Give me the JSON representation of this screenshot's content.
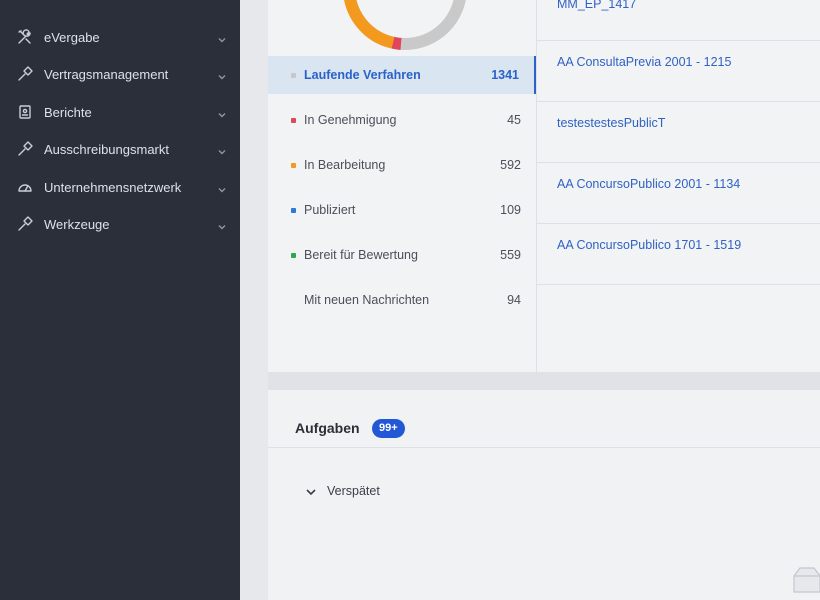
{
  "sidebar": {
    "items": [
      {
        "label": "eVergabe",
        "icon": "tools-icon"
      },
      {
        "label": "Vertragsmanagement",
        "icon": "hammer-icon"
      },
      {
        "label": "Berichte",
        "icon": "report-icon"
      },
      {
        "label": "Ausschreibungsmarkt",
        "icon": "hammer-icon"
      },
      {
        "label": "Unternehmensnetzwerk",
        "icon": "dashboard-icon"
      },
      {
        "label": "Werkzeuge",
        "icon": "hammer-icon"
      }
    ]
  },
  "statuses": [
    {
      "label": "Laufende Verfahren",
      "count": "1341",
      "color": "#c8c8c8",
      "active": true
    },
    {
      "label": "In Genehmigung",
      "count": "45",
      "color": "#e0455a",
      "active": false
    },
    {
      "label": "In Bearbeitung",
      "count": "592",
      "color": "#f39a1e",
      "active": false
    },
    {
      "label": "Publiziert",
      "count": "109",
      "color": "#2e78dc",
      "active": false
    },
    {
      "label": "Bereit für Bewertung",
      "count": "559",
      "color": "#2ea84d",
      "active": false
    },
    {
      "label": "Mit neuen Nachrichten",
      "count": "94",
      "color": "",
      "active": false
    }
  ],
  "procedures": [
    {
      "label": "MM_EP_1417"
    },
    {
      "label": "AA ConsultaPrevia 2001 - 1215"
    },
    {
      "label": "testestestesPublicT"
    },
    {
      "label": "AA ConcursoPublico 2001 - 1134"
    },
    {
      "label": "AA ConcursoPublico 1701 - 1519"
    }
  ],
  "tasks": {
    "title": "Aufgaben",
    "badge": "99+",
    "group_label": "Verspätet"
  },
  "colors": {
    "accent": "#2a62c9",
    "sidebar_bg": "#2a2f3a",
    "badge_bg": "#2258d6"
  }
}
